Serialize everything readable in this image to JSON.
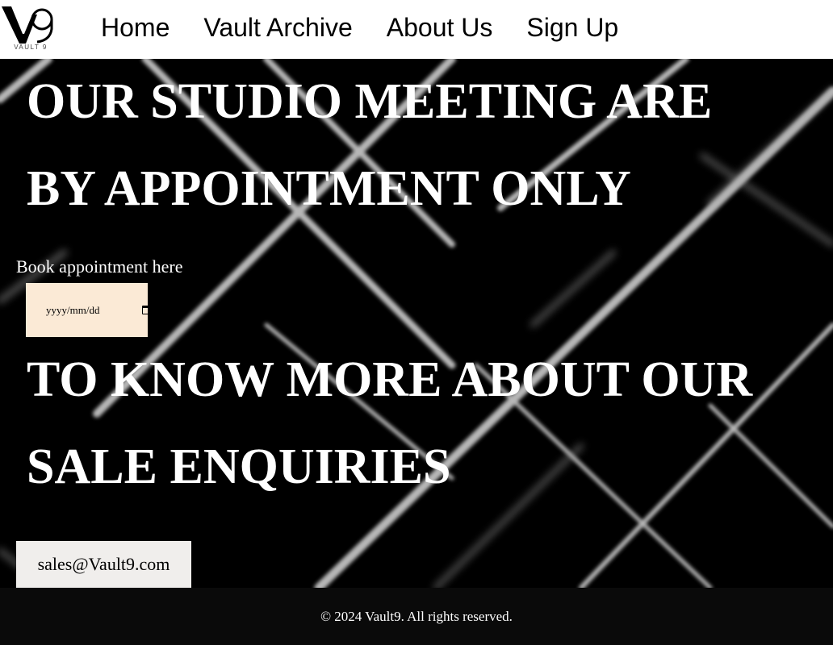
{
  "header": {
    "logo_text": "VAULT 9",
    "nav": [
      {
        "label": "Home"
      },
      {
        "label": "Vault Archive"
      },
      {
        "label": "About Us"
      },
      {
        "label": "Sign Up"
      }
    ]
  },
  "hero": {
    "heading_1_line_1": "OUR STUDIO MEETING ARE",
    "heading_1_line_2": "BY APPOINTMENT ONLY",
    "book_label": "Book appointment here",
    "date_placeholder": "yyyy/mm/dd",
    "heading_2_line_1": "TO KNOW MORE ABOUT OUR",
    "heading_2_line_2": "SALE ENQUIRIES",
    "email_button": "sales@Vault9.com"
  },
  "footer": {
    "copyright": "© 2024 Vault9. All rights reserved."
  },
  "colors": {
    "header_bg": "#ffffff",
    "hero_bg": "#000000",
    "date_box_bg": "#fbead6",
    "email_button_bg": "#f0eeec",
    "footer_bg": "#0a0a0a"
  }
}
